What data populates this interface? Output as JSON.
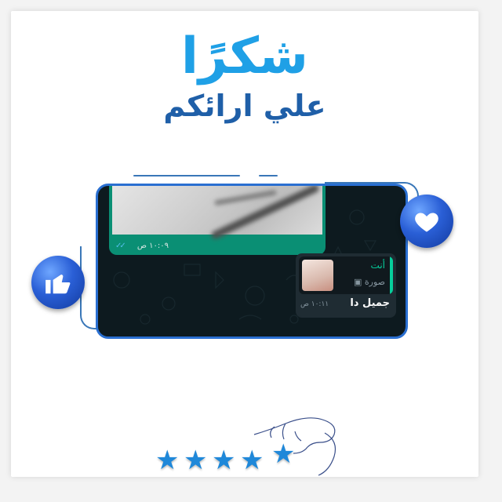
{
  "title": {
    "main": "شكرًا",
    "sub": "علي ارائكم"
  },
  "chat": {
    "photo_message": {
      "time": "١٠:٠٩ ص",
      "ticks": "✓✓"
    },
    "reply_message": {
      "quoted_name": "أنت",
      "quoted_kind": "صورة",
      "text": "جميل دا",
      "time": "١٠:١١ ص"
    }
  },
  "icons": {
    "like": "thumbs-up-icon",
    "love": "heart-icon",
    "rating": "star-icon"
  },
  "rating": {
    "stars": 5
  },
  "colors": {
    "title_light_blue": "#1fa0e6",
    "title_dark_blue": "#1f5fa8",
    "chat_background": "#0d1a1f",
    "frame_blue": "#2a6fd1",
    "badge_blue": "#2a5fd6",
    "star_blue": "#1f88d9"
  }
}
